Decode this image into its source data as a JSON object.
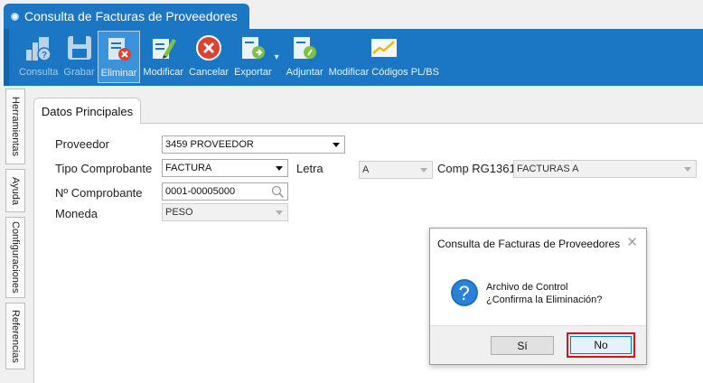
{
  "window": {
    "title": "Consulta de Facturas de Proveedores"
  },
  "toolbar": {
    "items": [
      {
        "label": "Consulta",
        "icon": "consult-icon"
      },
      {
        "label": "Grabar",
        "icon": "save-icon"
      },
      {
        "label": "Eliminar",
        "icon": "delete-document-icon"
      },
      {
        "label": "Modificar",
        "icon": "edit-icon"
      },
      {
        "label": "Cancelar",
        "icon": "cancel-icon"
      },
      {
        "label": "Exportar",
        "icon": "export-icon"
      },
      {
        "label": "Adjuntar",
        "icon": "attach-icon"
      },
      {
        "label": "Modificar Códigos PL/BS",
        "icon": "chart-icon"
      }
    ]
  },
  "side_tabs": [
    "Herramientas",
    "Ayuda",
    "Configuraciones",
    "Referencias"
  ],
  "tab": {
    "label": "Datos Principales"
  },
  "form": {
    "proveedor": {
      "label": "Proveedor",
      "value": "3459 PROVEEDOR"
    },
    "tipo": {
      "label": "Tipo Comprobante",
      "value": "FACTURA"
    },
    "letra": {
      "label": "Letra",
      "value": "A"
    },
    "comp": {
      "label": "Comp RG1361",
      "value": "FACTURAS A"
    },
    "nro": {
      "label": "Nº Comprobante",
      "value": "0001-00005000"
    },
    "moneda": {
      "label": "Moneda",
      "value": "PESO"
    }
  },
  "dialog": {
    "title": "Consulta de Facturas de Proveedores",
    "line1": "Archivo de Control",
    "line2": "¿Confirma la Eliminación?",
    "yes_label": "Sí",
    "no_label": "No"
  },
  "colors": {
    "brand": "#1b77c4",
    "highlight": "#d4141c"
  }
}
